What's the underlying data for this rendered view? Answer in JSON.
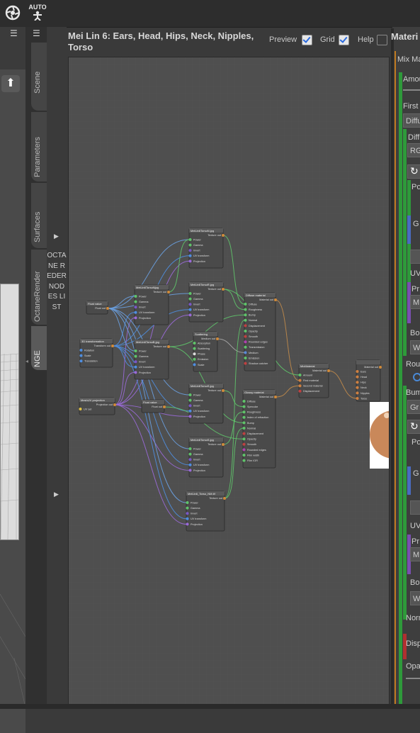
{
  "toolbar": {
    "icons": [
      "daz-logo-icon",
      "auto-figure-icon"
    ],
    "auto_label": "AUTO"
  },
  "side_tabs": [
    "Scene",
    "Parameters",
    "Surfaces",
    "OctaneRender",
    "NGE"
  ],
  "vertical_panel": {
    "label": "OCTANE REDER NODES LIST"
  },
  "header": {
    "title": "Mei Lin 6: Ears, Head, Hips, Neck, Nipples, Torso",
    "preview_label": "Preview",
    "preview_checked": true,
    "grid_label": "Grid",
    "grid_checked": true,
    "help_label": "Help",
    "help_checked": false
  },
  "right_panel": {
    "title": "Materi",
    "rows": [
      "Mix Ma",
      "Amou",
      "First",
      "Diffu",
      "Diffu",
      "RG",
      "Po",
      "G",
      "UV",
      "Pr",
      "M",
      "Bo",
      "W",
      "Rou",
      "Bum",
      "Gr",
      "Po",
      "G",
      "UV",
      "Pr",
      "M",
      "Bo",
      "W",
      "Norm",
      "Disp",
      "Opa"
    ],
    "colors": {
      "green": "#2e9a3a",
      "blue": "#4a6cc0",
      "purple": "#7a4fb0",
      "red": "#b03030",
      "orange": "#c07a20"
    }
  },
  "nodes": {
    "tex1": {
      "title": "MeiLin6TorsoN.jpg",
      "out": "Texture out",
      "inputs": [
        "Power",
        "Gamma",
        "Invert",
        "UV transform",
        "Projection"
      ]
    },
    "tex2": {
      "title": "MeiLin6TorsoR.jpg",
      "out": "Texture out",
      "inputs": [
        "Power",
        "Gamma",
        "Invert",
        "UV transform",
        "Projection"
      ]
    },
    "tex3": {
      "title": "MeiLin6TorsoNjpg",
      "out": "Texture out",
      "inputs": [
        "Power",
        "Gamma",
        "Invert",
        "UV transform",
        "Projection"
      ]
    },
    "tex4": {
      "title": "MeiLin6TorsoB.jpg",
      "out": "Texture out",
      "inputs": [
        "Power",
        "Gamma",
        "Invert",
        "UV transform",
        "Projection"
      ]
    },
    "tex5": {
      "title": "MeiLin6TorsoS.jpg",
      "out": "Texture out",
      "inputs": [
        "Power",
        "Gamma",
        "Invert",
        "UV transform",
        "Projection"
      ]
    },
    "tex6": {
      "title": "MeiLin6TorsoS.jpg",
      "out": "Texture out",
      "inputs": [
        "Power",
        "Gamma",
        "Invert",
        "UV transform",
        "Projection"
      ]
    },
    "tex7": {
      "title": "MeiLin6_Torso_NM.tif",
      "out": "Texture out",
      "inputs": [
        "Power",
        "Gamma",
        "Invert",
        "UV transform",
        "Projection"
      ]
    },
    "float1": {
      "title": "Float value",
      "out": "Float out"
    },
    "float2": {
      "title": "Float value",
      "out": "Float out"
    },
    "transform": {
      "title": "3D transformation",
      "out": "Transform out",
      "inputs": [
        "Rotation",
        "Scale",
        "Translation"
      ]
    },
    "meshuv": {
      "title": "MeshUV projection",
      "out": "Projection out",
      "inputs": [
        "UV set"
      ]
    },
    "scatter": {
      "title": "Scattering",
      "out": "Medium out",
      "inputs": [
        "Absorption",
        "Scattering",
        "Phase",
        "Emission",
        "Scale"
      ]
    },
    "diffuse": {
      "title": "Diffuse material",
      "out": "Material out",
      "inputs": [
        "Diffuse",
        "Roughness",
        "Bump",
        "Normal",
        "Displacement",
        "Opacity",
        "Smooth",
        "Rounded edges",
        "Transmission",
        "Medium",
        "Emission",
        "Shadow catcher"
      ]
    },
    "glossy": {
      "title": "Glossy material",
      "out": "Material out",
      "inputs": [
        "Diffuse",
        "Specular",
        "Roughness",
        "Index of refraction",
        "Bump",
        "Normal",
        "Displacement",
        "Opacity",
        "Smooth",
        "Rounded edges",
        "Film width",
        "Film IOR"
      ]
    },
    "mix": {
      "title": "MixMaterial",
      "out": "Material out",
      "inputs": [
        "Amount",
        "First material",
        "Second material",
        "Displacement"
      ]
    },
    "surfaces": {
      "title": "",
      "out": "Material out",
      "inputs": [
        "Ears",
        "Head",
        "Hips",
        "Neck",
        "Nipples",
        "Torso"
      ]
    }
  }
}
